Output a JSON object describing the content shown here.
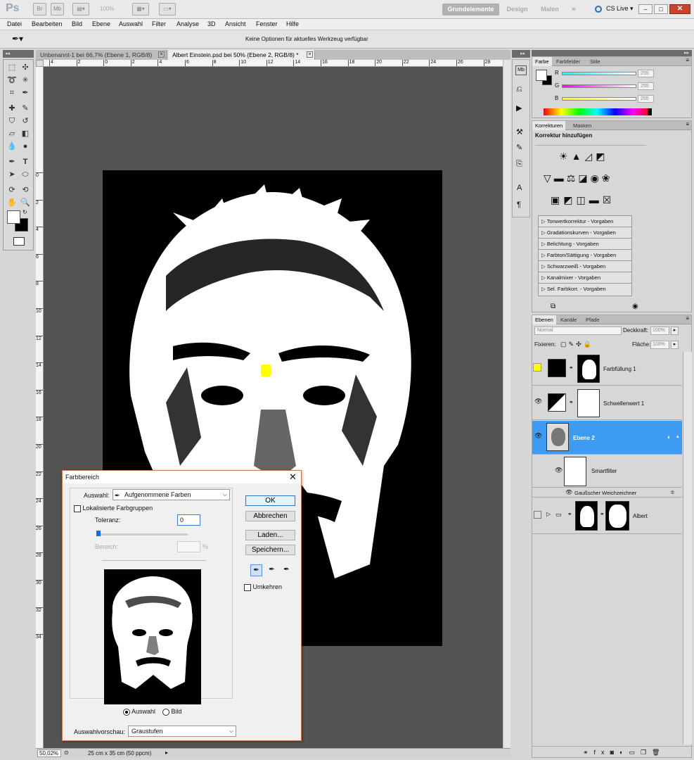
{
  "app": {
    "logo": "Ps",
    "zoom": "100%",
    "workspaces": [
      "Grundelemente",
      "Design",
      "Malen"
    ],
    "cslive": "CS Live"
  },
  "menu": [
    "Datei",
    "Bearbeiten",
    "Bild",
    "Ebene",
    "Auswahl",
    "Filter",
    "Analyse",
    "3D",
    "Ansicht",
    "Fenster",
    "Hilfe"
  ],
  "options": {
    "message": "Keine Optionen für aktuelles Werkzeug verfügbar"
  },
  "doc_tabs": [
    {
      "label": "Unbenannt-1 bei 66,7% (Ebene 1, RGB/8)"
    },
    {
      "label": "Albert Einstein.psd bei 50% (Ebene 2, RGB/8) *"
    }
  ],
  "ruler_h": [
    "4",
    "2",
    "0",
    "2",
    "4",
    "6",
    "8",
    "10",
    "12",
    "14",
    "16",
    "18",
    "20",
    "22",
    "24",
    "26",
    "28"
  ],
  "ruler_v": [
    "0",
    "2",
    "4",
    "6",
    "8",
    "10",
    "12",
    "14",
    "16",
    "18",
    "20",
    "22",
    "24",
    "26",
    "28",
    "30",
    "32",
    "34"
  ],
  "status": {
    "zoom": "50,02%",
    "docsize": "25 cm x 35 cm (50 ppcm)"
  },
  "color_panel": {
    "tabs": [
      "Farbe",
      "Farbfelder",
      "Stile"
    ],
    "sliders": [
      {
        "label": "R",
        "value": "255"
      },
      {
        "label": "G",
        "value": "255"
      },
      {
        "label": "B",
        "value": "255"
      }
    ]
  },
  "adjust_panel": {
    "tabs": [
      "Korrekturen",
      "Masken"
    ],
    "title": "Korrektur hinzufügen",
    "presets": [
      "Tonwertkorrektur - Vorgaben",
      "Gradationskurven - Vorgaben",
      "Belichtung - Vorgaben",
      "Farbton/Sättigung - Vorgaben",
      "Schwarzweiß - Vorgaben",
      "Kanalmixer - Vorgaben",
      "Sel. Farbkorr. - Vorgaben"
    ]
  },
  "layers_panel": {
    "tabs": [
      "Ebenen",
      "Kanäle",
      "Pfade"
    ],
    "blend_mode": "Normal",
    "opacity_label": "Deckkraft:",
    "opacity": "100%",
    "lock_label": "Fixieren:",
    "fill_label": "Fläche:",
    "fill": "100%",
    "layers": [
      {
        "name": "Farbfüllung 1"
      },
      {
        "name": "Schwellenwert 1"
      },
      {
        "name": "Ebene 2"
      },
      {
        "name": "Smartfilter"
      },
      {
        "name": "Gaußscher Weichzeichner"
      },
      {
        "name": "Albert"
      }
    ]
  },
  "dialog": {
    "title": "Farbbereich",
    "select_label": "Auswahl:",
    "select_value": "Aufgenommene Farben",
    "localized": "Lokalisierte Farbgruppen",
    "tolerance_label": "Toleranz:",
    "tolerance": "0",
    "range_label": "Bereich:",
    "range_unit": "%",
    "ok": "OK",
    "cancel": "Abbrechen",
    "load": "Laden...",
    "save": "Speichern...",
    "invert": "Umkehren",
    "radio_selection": "Auswahl",
    "radio_image": "Bild",
    "preview_label": "Auswahlvorschau:",
    "preview_value": "Graustufen"
  },
  "colors": {
    "accent": "#3d9bf2",
    "highlight": "#ffff00"
  }
}
